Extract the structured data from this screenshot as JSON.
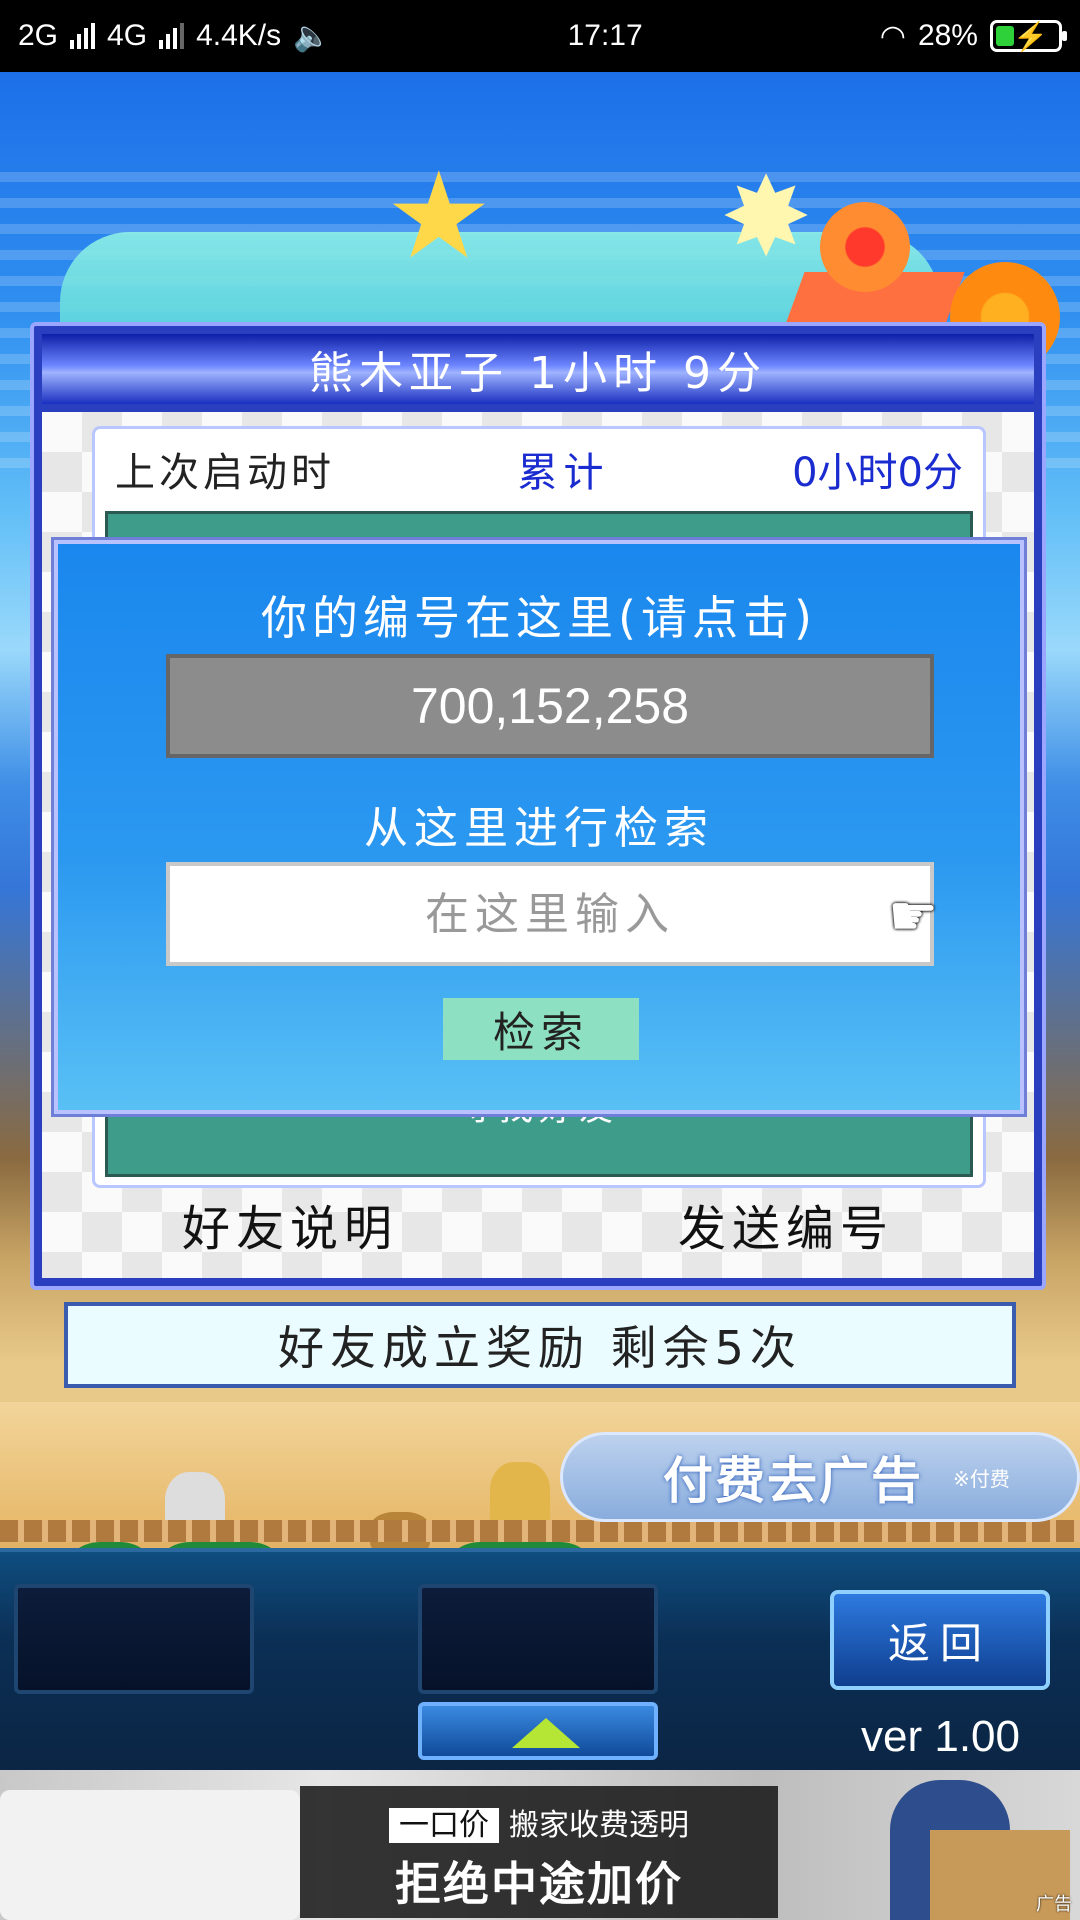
{
  "status_bar": {
    "network1": "2G",
    "network2": "4G",
    "speed": "4.4K/s",
    "time": "17:17",
    "battery_percent": "28%",
    "battery_level": 0.28
  },
  "panel": {
    "title": "熊木亚子  1小时 9分",
    "last_launch_label": "上次启动时",
    "total_label": "累计",
    "total_value": "0小时0分",
    "hidden_button_label": "寻找好友",
    "friend_help": "好友说明",
    "send_id": "发送编号"
  },
  "modal": {
    "id_heading": "你的编号在这里(请点击)",
    "id_value": "700,152,258",
    "search_heading": "从这里进行检索",
    "search_placeholder": "在这里输入",
    "search_button": "检索"
  },
  "reward": {
    "text": "好友成立奖励  剩余5次"
  },
  "remove_ads": {
    "label": "付费去广告",
    "note": "※付费"
  },
  "controls": {
    "back_button": "返回",
    "version": "ver 1.00"
  },
  "ad_banner": {
    "tag": "一口价",
    "line1": "搬家收费透明",
    "line2": "拒绝中途加价",
    "ad_mark": "广告"
  },
  "colors": {
    "panel_title_blue": "#0d1fa8",
    "modal_blue": "#1a87ee",
    "accent_dark_blue": "#1a2bd0",
    "search_button_green": "#8ee0c3"
  }
}
